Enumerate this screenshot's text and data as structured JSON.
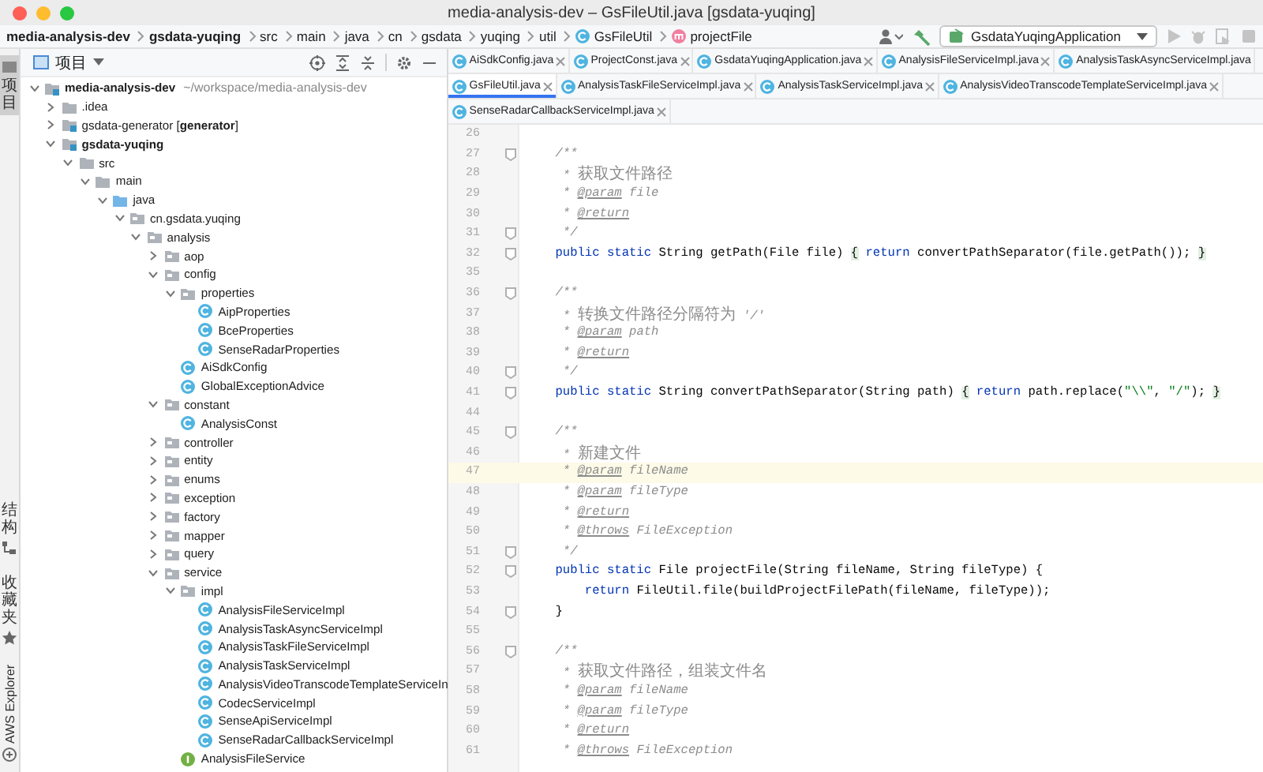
{
  "window": {
    "title": "media-analysis-dev – GsFileUtil.java [gsdata-yuqing]"
  },
  "breadcrumbs": [
    {
      "label": "media-analysis-dev",
      "kind": "module"
    },
    {
      "label": "gsdata-yuqing",
      "kind": "module"
    },
    {
      "label": "src",
      "kind": "dir"
    },
    {
      "label": "main",
      "kind": "dir"
    },
    {
      "label": "java",
      "kind": "dir"
    },
    {
      "label": "cn",
      "kind": "dir"
    },
    {
      "label": "gsdata",
      "kind": "dir"
    },
    {
      "label": "yuqing",
      "kind": "dir"
    },
    {
      "label": "util",
      "kind": "dir"
    },
    {
      "label": "GsFileUtil",
      "kind": "class"
    },
    {
      "label": "projectFile",
      "kind": "method"
    }
  ],
  "toolbar": {
    "run_config": "GsdataYuqingApplication"
  },
  "side_strip": {
    "top": [
      {
        "label": "项目",
        "kind": "cjk",
        "selected": true
      }
    ],
    "bottom": [
      {
        "label": "结构",
        "kind": "cjk",
        "selected": false
      },
      {
        "label": "收藏夹",
        "kind": "cjk",
        "selected": false
      },
      {
        "label": "AWS Explorer",
        "kind": "latin",
        "selected": false
      }
    ]
  },
  "project_panel": {
    "title": "项目",
    "tree": [
      {
        "label": "media-analysis-dev",
        "kind": "module",
        "bold": true,
        "note": "~/workspace/media-analysis-dev",
        "expanded": true,
        "children": [
          {
            "label": ".idea",
            "kind": "folder",
            "bold": false,
            "expanded": false
          },
          {
            "label": "gsdata-generator [**generator**]",
            "kind": "module",
            "bold": false,
            "expanded": false
          },
          {
            "label": "gsdata-yuqing",
            "kind": "module",
            "bold": true,
            "expanded": true,
            "children": [
              {
                "label": "src",
                "kind": "folder",
                "bold": false,
                "expanded": true,
                "children": [
                  {
                    "label": "main",
                    "kind": "folder",
                    "bold": false,
                    "expanded": true,
                    "children": [
                      {
                        "label": "java",
                        "kind": "source",
                        "bold": false,
                        "expanded": true,
                        "children": [
                          {
                            "label": "cn.gsdata.yuqing",
                            "kind": "package",
                            "bold": false,
                            "expanded": true,
                            "children": [
                              {
                                "label": "analysis",
                                "kind": "package",
                                "bold": false,
                                "expanded": true,
                                "children": [
                                  {
                                    "label": "aop",
                                    "kind": "package",
                                    "bold": false,
                                    "expanded": false
                                  },
                                  {
                                    "label": "config",
                                    "kind": "package",
                                    "bold": false,
                                    "expanded": true,
                                    "children": [
                                      {
                                        "label": "properties",
                                        "kind": "package",
                                        "bold": false,
                                        "expanded": true,
                                        "children": [
                                          {
                                            "label": "AipProperties",
                                            "kind": "class",
                                            "bold": false
                                          },
                                          {
                                            "label": "BceProperties",
                                            "kind": "class",
                                            "bold": false
                                          },
                                          {
                                            "label": "SenseRadarProperties",
                                            "kind": "class",
                                            "bold": false
                                          }
                                        ]
                                      },
                                      {
                                        "label": "AiSdkConfig",
                                        "kind": "class",
                                        "bold": false
                                      },
                                      {
                                        "label": "GlobalExceptionAdvice",
                                        "kind": "class",
                                        "bold": false
                                      }
                                    ]
                                  },
                                  {
                                    "label": "constant",
                                    "kind": "package",
                                    "bold": false,
                                    "expanded": true,
                                    "children": [
                                      {
                                        "label": "AnalysisConst",
                                        "kind": "class",
                                        "bold": false
                                      }
                                    ]
                                  },
                                  {
                                    "label": "controller",
                                    "kind": "package",
                                    "bold": false,
                                    "expanded": false
                                  },
                                  {
                                    "label": "entity",
                                    "kind": "package",
                                    "bold": false,
                                    "expanded": false
                                  },
                                  {
                                    "label": "enums",
                                    "kind": "package",
                                    "bold": false,
                                    "expanded": false
                                  },
                                  {
                                    "label": "exception",
                                    "kind": "package",
                                    "bold": false,
                                    "expanded": false
                                  },
                                  {
                                    "label": "factory",
                                    "kind": "package",
                                    "bold": false,
                                    "expanded": false
                                  },
                                  {
                                    "label": "mapper",
                                    "kind": "package",
                                    "bold": false,
                                    "expanded": false
                                  },
                                  {
                                    "label": "query",
                                    "kind": "package",
                                    "bold": false,
                                    "expanded": false
                                  },
                                  {
                                    "label": "service",
                                    "kind": "package",
                                    "bold": false,
                                    "expanded": true,
                                    "children": [
                                      {
                                        "label": "impl",
                                        "kind": "package",
                                        "bold": false,
                                        "expanded": true,
                                        "children": [
                                          {
                                            "label": "AnalysisFileServiceImpl",
                                            "kind": "class",
                                            "bold": false
                                          },
                                          {
                                            "label": "AnalysisTaskAsyncServiceImpl",
                                            "kind": "class",
                                            "bold": false
                                          },
                                          {
                                            "label": "AnalysisTaskFileServiceImpl",
                                            "kind": "class",
                                            "bold": false
                                          },
                                          {
                                            "label": "AnalysisTaskServiceImpl",
                                            "kind": "class",
                                            "bold": false
                                          },
                                          {
                                            "label": "AnalysisVideoTranscodeTemplateServiceIn",
                                            "kind": "class",
                                            "bold": false
                                          },
                                          {
                                            "label": "CodecServiceImpl",
                                            "kind": "class",
                                            "bold": false
                                          },
                                          {
                                            "label": "SenseApiServiceImpl",
                                            "kind": "class",
                                            "bold": false
                                          },
                                          {
                                            "label": "SenseRadarCallbackServiceImpl",
                                            "kind": "class",
                                            "bold": false
                                          }
                                        ]
                                      },
                                      {
                                        "label": "AnalysisFileService",
                                        "kind": "interface",
                                        "bold": false
                                      }
                                    ]
                                  }
                                ]
                              }
                            ]
                          }
                        ]
                      }
                    ]
                  }
                ]
              }
            ]
          }
        ]
      }
    ]
  },
  "editor": {
    "tab_rows": [
      [
        {
          "label": "AiSdkConfig.java",
          "selected": false,
          "closable": true
        },
        {
          "label": "ProjectConst.java",
          "selected": false,
          "closable": true
        },
        {
          "label": "GsdataYuqingApplication.java",
          "selected": false,
          "closable": true
        },
        {
          "label": "AnalysisFileServiceImpl.java",
          "selected": false,
          "closable": true
        },
        {
          "label": "AnalysisTaskAsyncServiceImpl.java",
          "selected": false,
          "closable": false
        }
      ],
      [
        {
          "label": "GsFileUtil.java",
          "selected": true,
          "closable": true
        },
        {
          "label": "AnalysisTaskFileServiceImpl.java",
          "selected": false,
          "closable": true
        },
        {
          "label": "AnalysisTaskServiceImpl.java",
          "selected": false,
          "closable": true
        },
        {
          "label": "AnalysisVideoTranscodeTemplateServiceImpl.java",
          "selected": false,
          "closable": true
        }
      ],
      [
        {
          "label": "SenseRadarCallbackServiceImpl.java",
          "selected": false,
          "closable": true
        }
      ]
    ],
    "lines": [
      {
        "number": "26",
        "fold_marker": false,
        "current": false
      },
      {
        "number": "27",
        "fold_marker": true,
        "current": false,
        "tokens": [
          {
            "kind": "doc",
            "text": "    /**"
          }
        ]
      },
      {
        "number": "28",
        "fold_marker": false,
        "current": false,
        "tokens": [
          {
            "kind": "doc",
            "text": "     * "
          },
          {
            "kind": "doc-cjk",
            "text": "获取文件路径"
          }
        ]
      },
      {
        "number": "29",
        "fold_marker": false,
        "current": false,
        "tokens": [
          {
            "kind": "doc",
            "text": "     * "
          },
          {
            "kind": "tag",
            "text": "@param"
          },
          {
            "kind": "pname",
            "text": " file"
          }
        ]
      },
      {
        "number": "30",
        "fold_marker": false,
        "current": false,
        "tokens": [
          {
            "kind": "doc",
            "text": "     * "
          },
          {
            "kind": "tag",
            "text": "@return"
          }
        ]
      },
      {
        "number": "31",
        "fold_marker": true,
        "current": false,
        "tokens": [
          {
            "kind": "doc",
            "text": "     */"
          }
        ]
      },
      {
        "number": "32",
        "fold_marker": true,
        "current": false,
        "tokens": [
          {
            "kind": "kw",
            "text": "    public static"
          },
          {
            "kind": "plain",
            "text": " String getPath(File file) "
          },
          {
            "kind": "fold",
            "text": "{"
          },
          {
            "kind": "kw",
            "text": " return"
          },
          {
            "kind": "plain",
            "text": " convertPathSeparator(file.getPath()); "
          },
          {
            "kind": "fold",
            "text": "}"
          }
        ]
      },
      {
        "number": "35",
        "fold_marker": false,
        "current": false
      },
      {
        "number": "36",
        "fold_marker": true,
        "current": false,
        "tokens": [
          {
            "kind": "doc",
            "text": "    /**"
          }
        ]
      },
      {
        "number": "37",
        "fold_marker": false,
        "current": false,
        "tokens": [
          {
            "kind": "doc",
            "text": "     * "
          },
          {
            "kind": "doc-cjk",
            "text": "转换文件路径分隔符为"
          },
          {
            "kind": "doc",
            "text": " '/'"
          }
        ]
      },
      {
        "number": "38",
        "fold_marker": false,
        "current": false,
        "tokens": [
          {
            "kind": "doc",
            "text": "     * "
          },
          {
            "kind": "tag",
            "text": "@param"
          },
          {
            "kind": "pname",
            "text": " path"
          }
        ]
      },
      {
        "number": "39",
        "fold_marker": false,
        "current": false,
        "tokens": [
          {
            "kind": "doc",
            "text": "     * "
          },
          {
            "kind": "tag",
            "text": "@return"
          }
        ]
      },
      {
        "number": "40",
        "fold_marker": true,
        "current": false,
        "tokens": [
          {
            "kind": "doc",
            "text": "     */"
          }
        ]
      },
      {
        "number": "41",
        "fold_marker": true,
        "current": false,
        "tokens": [
          {
            "kind": "kw",
            "text": "    public static"
          },
          {
            "kind": "plain",
            "text": " String convertPathSeparator(String path) "
          },
          {
            "kind": "fold",
            "text": "{"
          },
          {
            "kind": "kw",
            "text": " return"
          },
          {
            "kind": "plain",
            "text": " path.replace("
          },
          {
            "kind": "str",
            "text": "\"\\\\\""
          },
          {
            "kind": "plain",
            "text": ", "
          },
          {
            "kind": "str",
            "text": "\"/\""
          },
          {
            "kind": "plain",
            "text": "); "
          },
          {
            "kind": "fold",
            "text": "}"
          }
        ]
      },
      {
        "number": "44",
        "fold_marker": false,
        "current": false
      },
      {
        "number": "45",
        "fold_marker": true,
        "current": false,
        "tokens": [
          {
            "kind": "doc",
            "text": "    /**"
          }
        ]
      },
      {
        "number": "46",
        "fold_marker": false,
        "current": false,
        "tokens": [
          {
            "kind": "doc",
            "text": "     * "
          },
          {
            "kind": "doc-cjk",
            "text": "新建文件"
          }
        ]
      },
      {
        "number": "47",
        "fold_marker": false,
        "current": true,
        "tokens": [
          {
            "kind": "doc",
            "text": "     * "
          },
          {
            "kind": "tag",
            "text": "@param"
          },
          {
            "kind": "pname",
            "text": " fileName"
          }
        ]
      },
      {
        "number": "48",
        "fold_marker": false,
        "current": false,
        "tokens": [
          {
            "kind": "doc",
            "text": "     * "
          },
          {
            "kind": "tag",
            "text": "@param"
          },
          {
            "kind": "pname",
            "text": " fileType"
          }
        ]
      },
      {
        "number": "49",
        "fold_marker": false,
        "current": false,
        "tokens": [
          {
            "kind": "doc",
            "text": "     * "
          },
          {
            "kind": "tag",
            "text": "@return"
          }
        ]
      },
      {
        "number": "50",
        "fold_marker": false,
        "current": false,
        "tokens": [
          {
            "kind": "doc",
            "text": "     * "
          },
          {
            "kind": "tag",
            "text": "@throws"
          },
          {
            "kind": "pname",
            "text": " FileException"
          }
        ]
      },
      {
        "number": "51",
        "fold_marker": true,
        "current": false,
        "tokens": [
          {
            "kind": "doc",
            "text": "     */"
          }
        ]
      },
      {
        "number": "52",
        "fold_marker": true,
        "current": false,
        "tokens": [
          {
            "kind": "kw",
            "text": "    public static"
          },
          {
            "kind": "plain",
            "text": " File projectFile(String fileName, String fileType) {"
          }
        ]
      },
      {
        "number": "53",
        "fold_marker": false,
        "current": false,
        "tokens": [
          {
            "kind": "kw",
            "text": "        return"
          },
          {
            "kind": "plain",
            "text": " FileUtil.file(buildProjectFilePath(fileName, fileType));"
          }
        ]
      },
      {
        "number": "54",
        "fold_marker": true,
        "current": false,
        "tokens": [
          {
            "kind": "plain",
            "text": "    }"
          }
        ]
      },
      {
        "number": "55",
        "fold_marker": false,
        "current": false
      },
      {
        "number": "56",
        "fold_marker": true,
        "current": false,
        "tokens": [
          {
            "kind": "doc",
            "text": "    /**"
          }
        ]
      },
      {
        "number": "57",
        "fold_marker": false,
        "current": false,
        "tokens": [
          {
            "kind": "doc",
            "text": "     * "
          },
          {
            "kind": "doc-cjk",
            "text": "获取文件路径，组装文件名"
          }
        ]
      },
      {
        "number": "58",
        "fold_marker": false,
        "current": false,
        "tokens": [
          {
            "kind": "doc",
            "text": "     * "
          },
          {
            "kind": "tag",
            "text": "@param"
          },
          {
            "kind": "pname",
            "text": " fileName"
          }
        ]
      },
      {
        "number": "59",
        "fold_marker": false,
        "current": false,
        "tokens": [
          {
            "kind": "doc",
            "text": "     * "
          },
          {
            "kind": "tag",
            "text": "@param"
          },
          {
            "kind": "pname",
            "text": " fileType"
          }
        ]
      },
      {
        "number": "60",
        "fold_marker": false,
        "current": false,
        "tokens": [
          {
            "kind": "doc",
            "text": "     * "
          },
          {
            "kind": "tag",
            "text": "@return"
          }
        ]
      },
      {
        "number": "61",
        "fold_marker": false,
        "current": false,
        "tokens": [
          {
            "kind": "doc",
            "text": "     * "
          },
          {
            "kind": "tag",
            "text": "@throws"
          },
          {
            "kind": "pname",
            "text": " FileException"
          }
        ]
      }
    ]
  }
}
